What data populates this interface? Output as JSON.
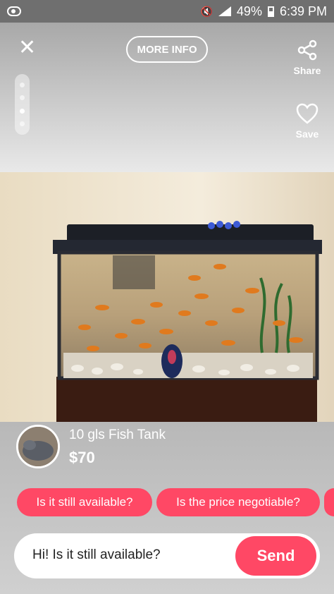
{
  "status_bar": {
    "battery": "49%",
    "time": "6:39 PM"
  },
  "top_bar": {
    "more_info_label": "MORE INFO",
    "share_label": "Share",
    "save_label": "Save",
    "photo_count": 4,
    "active_photo_index": 2
  },
  "listing": {
    "title": "10 gls Fish Tank",
    "price": "$70"
  },
  "quick_replies": [
    "Is it still available?",
    "Is the price negotiable?"
  ],
  "message": {
    "value": "Hi! Is it still available?",
    "send_label": "Send"
  },
  "colors": {
    "accent": "#ff4865"
  }
}
